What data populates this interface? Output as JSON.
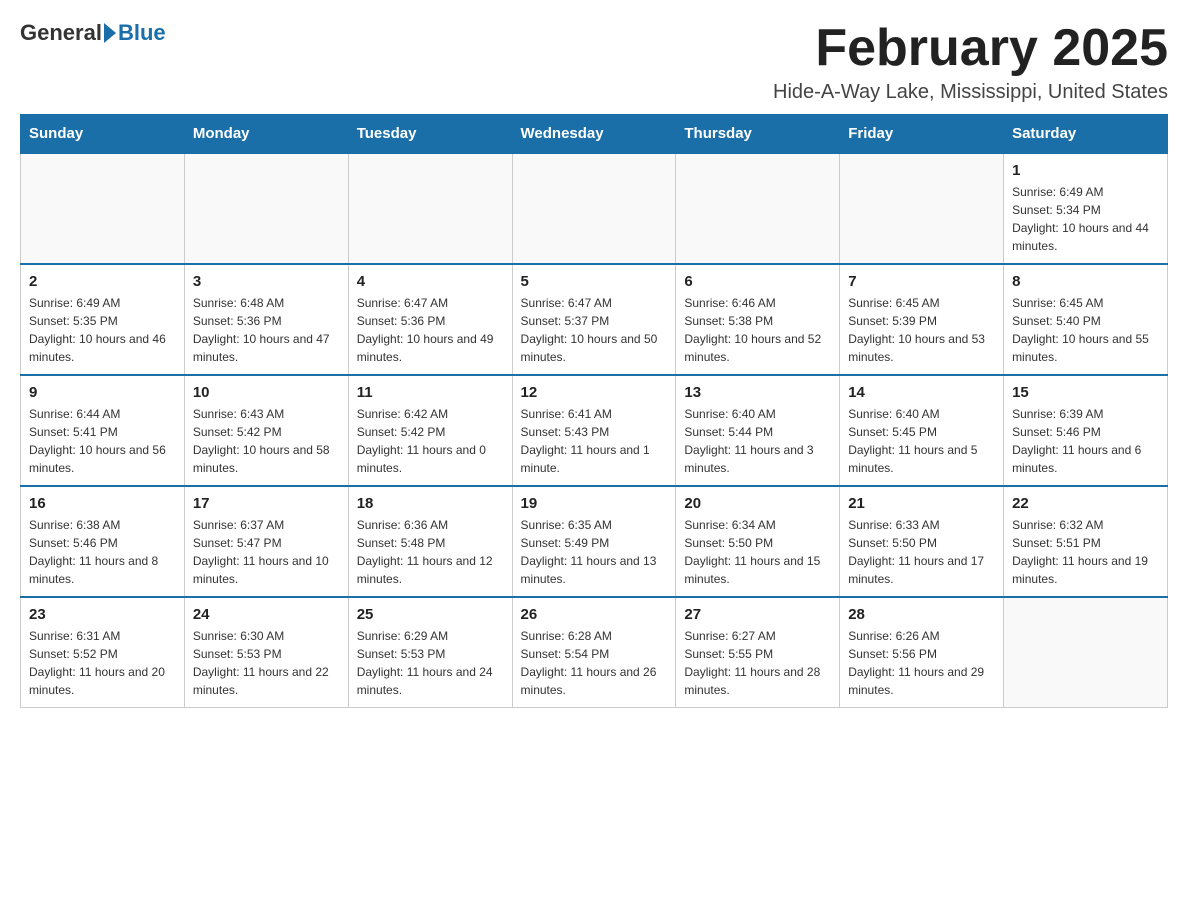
{
  "header": {
    "logo_general": "General",
    "logo_blue": "Blue",
    "month_title": "February 2025",
    "location": "Hide-A-Way Lake, Mississippi, United States"
  },
  "weekdays": [
    "Sunday",
    "Monday",
    "Tuesday",
    "Wednesday",
    "Thursday",
    "Friday",
    "Saturday"
  ],
  "weeks": [
    [
      {
        "day": "",
        "info": ""
      },
      {
        "day": "",
        "info": ""
      },
      {
        "day": "",
        "info": ""
      },
      {
        "day": "",
        "info": ""
      },
      {
        "day": "",
        "info": ""
      },
      {
        "day": "",
        "info": ""
      },
      {
        "day": "1",
        "info": "Sunrise: 6:49 AM\nSunset: 5:34 PM\nDaylight: 10 hours and 44 minutes."
      }
    ],
    [
      {
        "day": "2",
        "info": "Sunrise: 6:49 AM\nSunset: 5:35 PM\nDaylight: 10 hours and 46 minutes."
      },
      {
        "day": "3",
        "info": "Sunrise: 6:48 AM\nSunset: 5:36 PM\nDaylight: 10 hours and 47 minutes."
      },
      {
        "day": "4",
        "info": "Sunrise: 6:47 AM\nSunset: 5:36 PM\nDaylight: 10 hours and 49 minutes."
      },
      {
        "day": "5",
        "info": "Sunrise: 6:47 AM\nSunset: 5:37 PM\nDaylight: 10 hours and 50 minutes."
      },
      {
        "day": "6",
        "info": "Sunrise: 6:46 AM\nSunset: 5:38 PM\nDaylight: 10 hours and 52 minutes."
      },
      {
        "day": "7",
        "info": "Sunrise: 6:45 AM\nSunset: 5:39 PM\nDaylight: 10 hours and 53 minutes."
      },
      {
        "day": "8",
        "info": "Sunrise: 6:45 AM\nSunset: 5:40 PM\nDaylight: 10 hours and 55 minutes."
      }
    ],
    [
      {
        "day": "9",
        "info": "Sunrise: 6:44 AM\nSunset: 5:41 PM\nDaylight: 10 hours and 56 minutes."
      },
      {
        "day": "10",
        "info": "Sunrise: 6:43 AM\nSunset: 5:42 PM\nDaylight: 10 hours and 58 minutes."
      },
      {
        "day": "11",
        "info": "Sunrise: 6:42 AM\nSunset: 5:42 PM\nDaylight: 11 hours and 0 minutes."
      },
      {
        "day": "12",
        "info": "Sunrise: 6:41 AM\nSunset: 5:43 PM\nDaylight: 11 hours and 1 minute."
      },
      {
        "day": "13",
        "info": "Sunrise: 6:40 AM\nSunset: 5:44 PM\nDaylight: 11 hours and 3 minutes."
      },
      {
        "day": "14",
        "info": "Sunrise: 6:40 AM\nSunset: 5:45 PM\nDaylight: 11 hours and 5 minutes."
      },
      {
        "day": "15",
        "info": "Sunrise: 6:39 AM\nSunset: 5:46 PM\nDaylight: 11 hours and 6 minutes."
      }
    ],
    [
      {
        "day": "16",
        "info": "Sunrise: 6:38 AM\nSunset: 5:46 PM\nDaylight: 11 hours and 8 minutes."
      },
      {
        "day": "17",
        "info": "Sunrise: 6:37 AM\nSunset: 5:47 PM\nDaylight: 11 hours and 10 minutes."
      },
      {
        "day": "18",
        "info": "Sunrise: 6:36 AM\nSunset: 5:48 PM\nDaylight: 11 hours and 12 minutes."
      },
      {
        "day": "19",
        "info": "Sunrise: 6:35 AM\nSunset: 5:49 PM\nDaylight: 11 hours and 13 minutes."
      },
      {
        "day": "20",
        "info": "Sunrise: 6:34 AM\nSunset: 5:50 PM\nDaylight: 11 hours and 15 minutes."
      },
      {
        "day": "21",
        "info": "Sunrise: 6:33 AM\nSunset: 5:50 PM\nDaylight: 11 hours and 17 minutes."
      },
      {
        "day": "22",
        "info": "Sunrise: 6:32 AM\nSunset: 5:51 PM\nDaylight: 11 hours and 19 minutes."
      }
    ],
    [
      {
        "day": "23",
        "info": "Sunrise: 6:31 AM\nSunset: 5:52 PM\nDaylight: 11 hours and 20 minutes."
      },
      {
        "day": "24",
        "info": "Sunrise: 6:30 AM\nSunset: 5:53 PM\nDaylight: 11 hours and 22 minutes."
      },
      {
        "day": "25",
        "info": "Sunrise: 6:29 AM\nSunset: 5:53 PM\nDaylight: 11 hours and 24 minutes."
      },
      {
        "day": "26",
        "info": "Sunrise: 6:28 AM\nSunset: 5:54 PM\nDaylight: 11 hours and 26 minutes."
      },
      {
        "day": "27",
        "info": "Sunrise: 6:27 AM\nSunset: 5:55 PM\nDaylight: 11 hours and 28 minutes."
      },
      {
        "day": "28",
        "info": "Sunrise: 6:26 AM\nSunset: 5:56 PM\nDaylight: 11 hours and 29 minutes."
      },
      {
        "day": "",
        "info": ""
      }
    ]
  ]
}
